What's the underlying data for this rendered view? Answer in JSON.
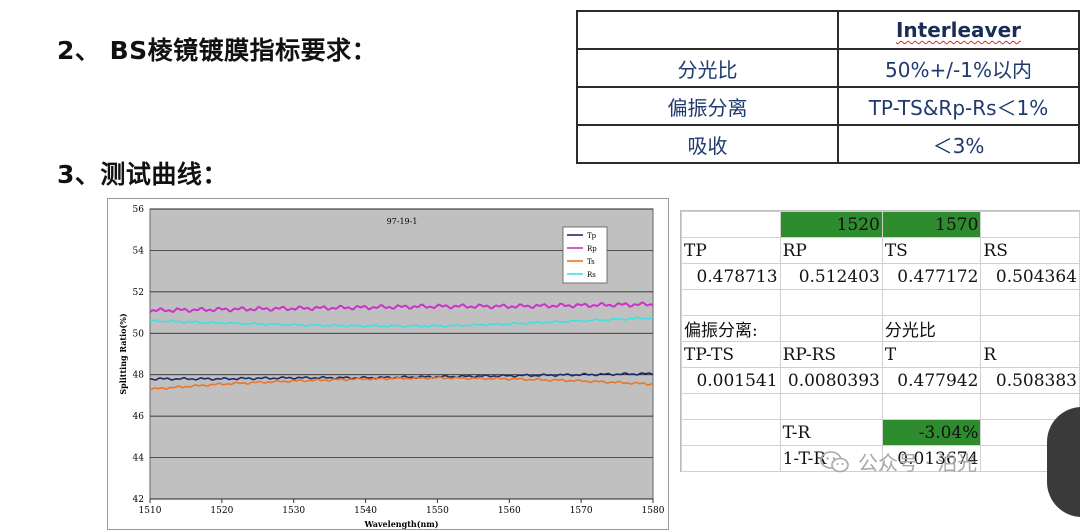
{
  "headings": {
    "section2": "2、 BS棱镜镀膜指标要求：",
    "section3": "3、测试曲线："
  },
  "requirements": {
    "header": "Interleaver",
    "rows": [
      {
        "label": "分光比",
        "value": "50%+/-1%以内"
      },
      {
        "label": "偏振分离",
        "value": "TP-TS&Rp-Rs＜1%"
      },
      {
        "label": "吸收",
        "value": "＜3%"
      }
    ]
  },
  "chart_data": {
    "type": "line",
    "title": "97-19-1",
    "xlabel": "Wavelength(nm)",
    "ylabel": "Splitting Ratio(%)",
    "xlim": [
      1510,
      1580
    ],
    "ylim": [
      42,
      56
    ],
    "xticks": [
      "1510",
      "1520",
      "1530",
      "1540",
      "1550",
      "1560",
      "1570",
      "1580"
    ],
    "yticks": [
      "42",
      "44",
      "46",
      "48",
      "50",
      "52",
      "54",
      "56"
    ],
    "legend_position": "top-right",
    "grid": true,
    "series": [
      {
        "name": "Tp",
        "color": "#1f2a6b",
        "x": [
          1510,
          1520,
          1530,
          1540,
          1550,
          1560,
          1570,
          1580
        ],
        "values": [
          47.8,
          47.8,
          47.85,
          47.85,
          47.9,
          47.95,
          48.0,
          48.05
        ]
      },
      {
        "name": "Rp",
        "color": "#cc33cc",
        "x": [
          1510,
          1520,
          1530,
          1540,
          1550,
          1560,
          1570,
          1580
        ],
        "values": [
          51.1,
          51.15,
          51.2,
          51.25,
          51.3,
          51.3,
          51.35,
          51.4
        ]
      },
      {
        "name": "Ts",
        "color": "#e8772a",
        "x": [
          1510,
          1520,
          1530,
          1540,
          1550,
          1560,
          1570,
          1580
        ],
        "values": [
          47.3,
          47.55,
          47.7,
          47.8,
          47.85,
          47.8,
          47.7,
          47.55
        ]
      },
      {
        "name": "Rs",
        "color": "#40e0e0",
        "x": [
          1510,
          1520,
          1530,
          1540,
          1550,
          1560,
          1570,
          1580
        ],
        "values": [
          50.6,
          50.5,
          50.4,
          50.35,
          50.35,
          50.45,
          50.6,
          50.75
        ]
      }
    ]
  },
  "sheet": {
    "rows": [
      [
        "",
        "1520",
        "1570",
        ""
      ],
      [
        "TP",
        "RP",
        "TS",
        "RS"
      ],
      [
        "0.478713",
        "0.512403",
        "0.477172",
        "0.504364"
      ],
      [
        "",
        "",
        "",
        ""
      ],
      [
        "偏振分离:",
        "",
        "分光比",
        ""
      ],
      [
        "TP-TS",
        "RP-RS",
        "T",
        "R"
      ],
      [
        "0.001541",
        "0.0080393",
        "0.477942",
        "0.508383"
      ],
      [
        "",
        "",
        "",
        ""
      ],
      [
        "",
        "T-R",
        "-3.04%",
        ""
      ],
      [
        "",
        "1-T-R",
        "0.013674",
        ""
      ]
    ],
    "green_cells": [
      "0.1",
      "0.2",
      "8.2"
    ],
    "right_aligned": [
      "0.1",
      "0.2",
      "2.0",
      "2.1",
      "2.2",
      "2.3",
      "6.0",
      "6.1",
      "6.2",
      "6.3",
      "8.2",
      "9.2"
    ]
  },
  "watermark": {
    "text": "公众号 · 泊光",
    "icon": "wechat-icon"
  }
}
